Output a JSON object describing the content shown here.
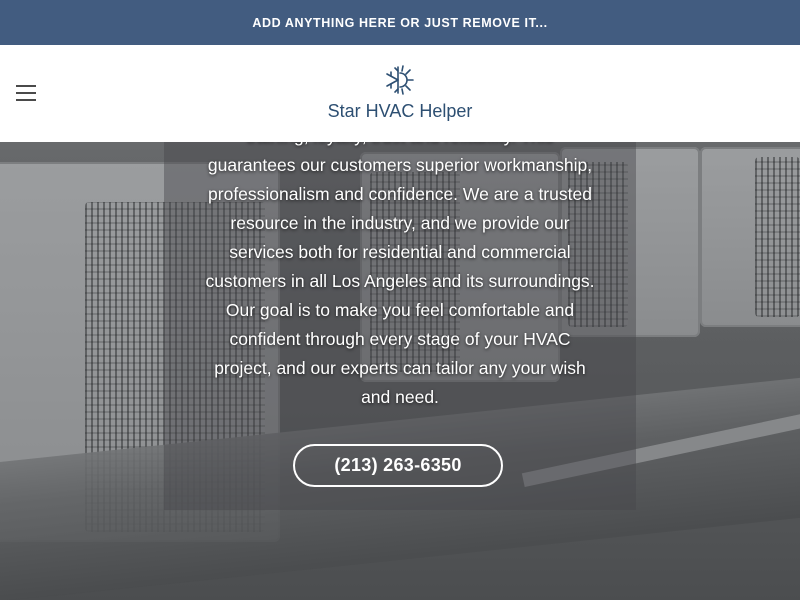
{
  "topbar": {
    "text": "ADD ANYTHING HERE OR JUST REMOVE IT..."
  },
  "header": {
    "brand_name": "Star HVAC Helper",
    "brand_color": "#2d4f72",
    "menu_icon": "hamburger-menu-icon",
    "logo_icon": "snowflake-sun-logo-icon"
  },
  "hero": {
    "paragraph_lines": [
      "training, loyalty, trust and reliability. This",
      "guarantees our customers superior workmanship,",
      "professionalism and confidence. We are a trusted",
      "resource in the industry, and we provide our",
      "services both for residential and commercial",
      "customers in all Los Angeles and its surroundings.",
      "Our goal is to make you feel comfortable and",
      "confident through every stage of your HVAC",
      "project, and our experts can tailor any your wish",
      "and need."
    ],
    "phone_button": "(213) 263-6350"
  },
  "colors": {
    "topbar_bg": "#425c80",
    "button_border": "#ffffff"
  }
}
